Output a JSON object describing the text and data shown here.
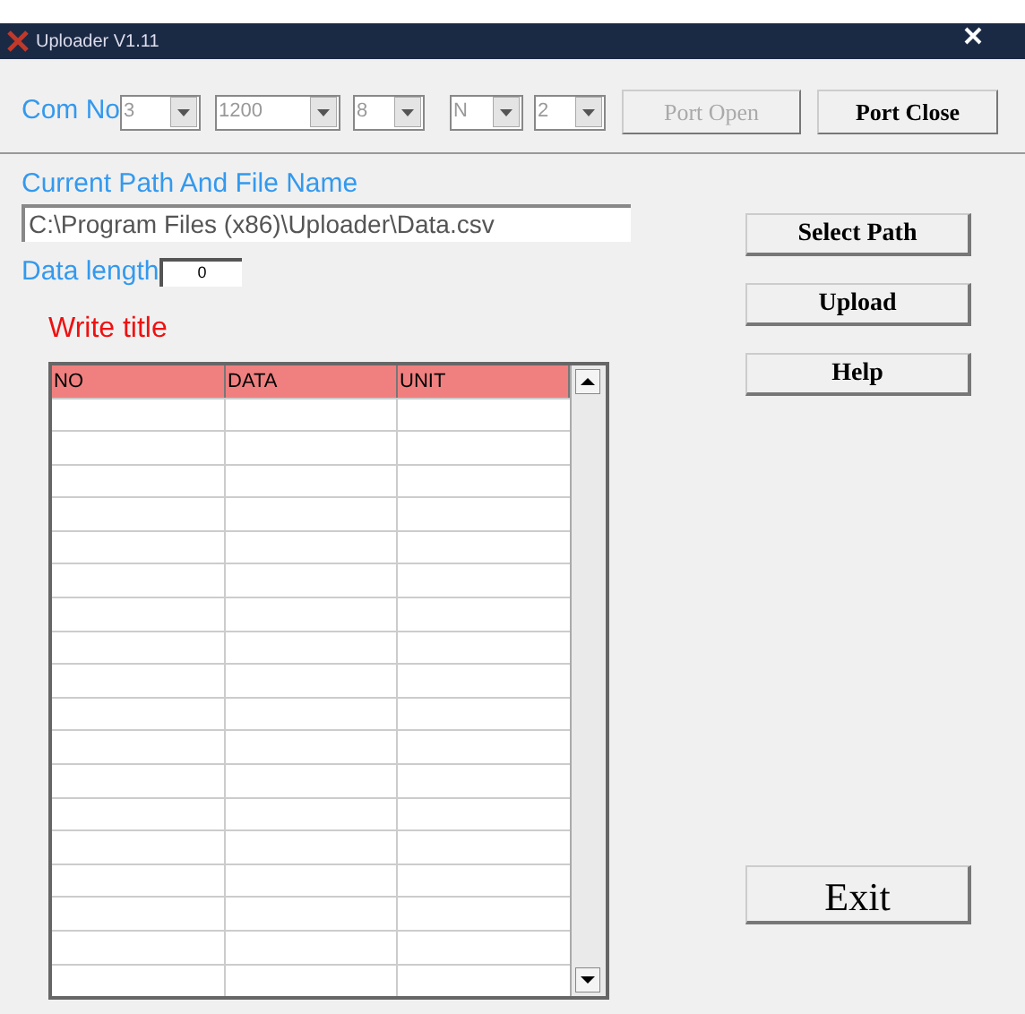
{
  "window": {
    "title": "Uploader V1.11"
  },
  "com": {
    "label": "Com No",
    "combos": [
      {
        "value": "3"
      },
      {
        "value": "1200"
      },
      {
        "value": "8"
      },
      {
        "value": "N"
      },
      {
        "value": "2"
      }
    ]
  },
  "port_buttons": [
    {
      "label": "Port Open",
      "disabled": true
    },
    {
      "label": "Port Close",
      "disabled": false
    }
  ],
  "path": {
    "label": "Current Path And File Name",
    "value": "C:\\Program Files (x86)\\Uploader\\Data.csv"
  },
  "data_length": {
    "label": "Data length",
    "value": "0"
  },
  "table": {
    "title": "Write title",
    "columns": [
      "NO",
      "DATA",
      "UNIT"
    ]
  },
  "side_buttons": [
    {
      "label": "Select Path"
    },
    {
      "label": "Upload"
    },
    {
      "label": "Help"
    }
  ],
  "exit_button": {
    "label": "Exit"
  }
}
